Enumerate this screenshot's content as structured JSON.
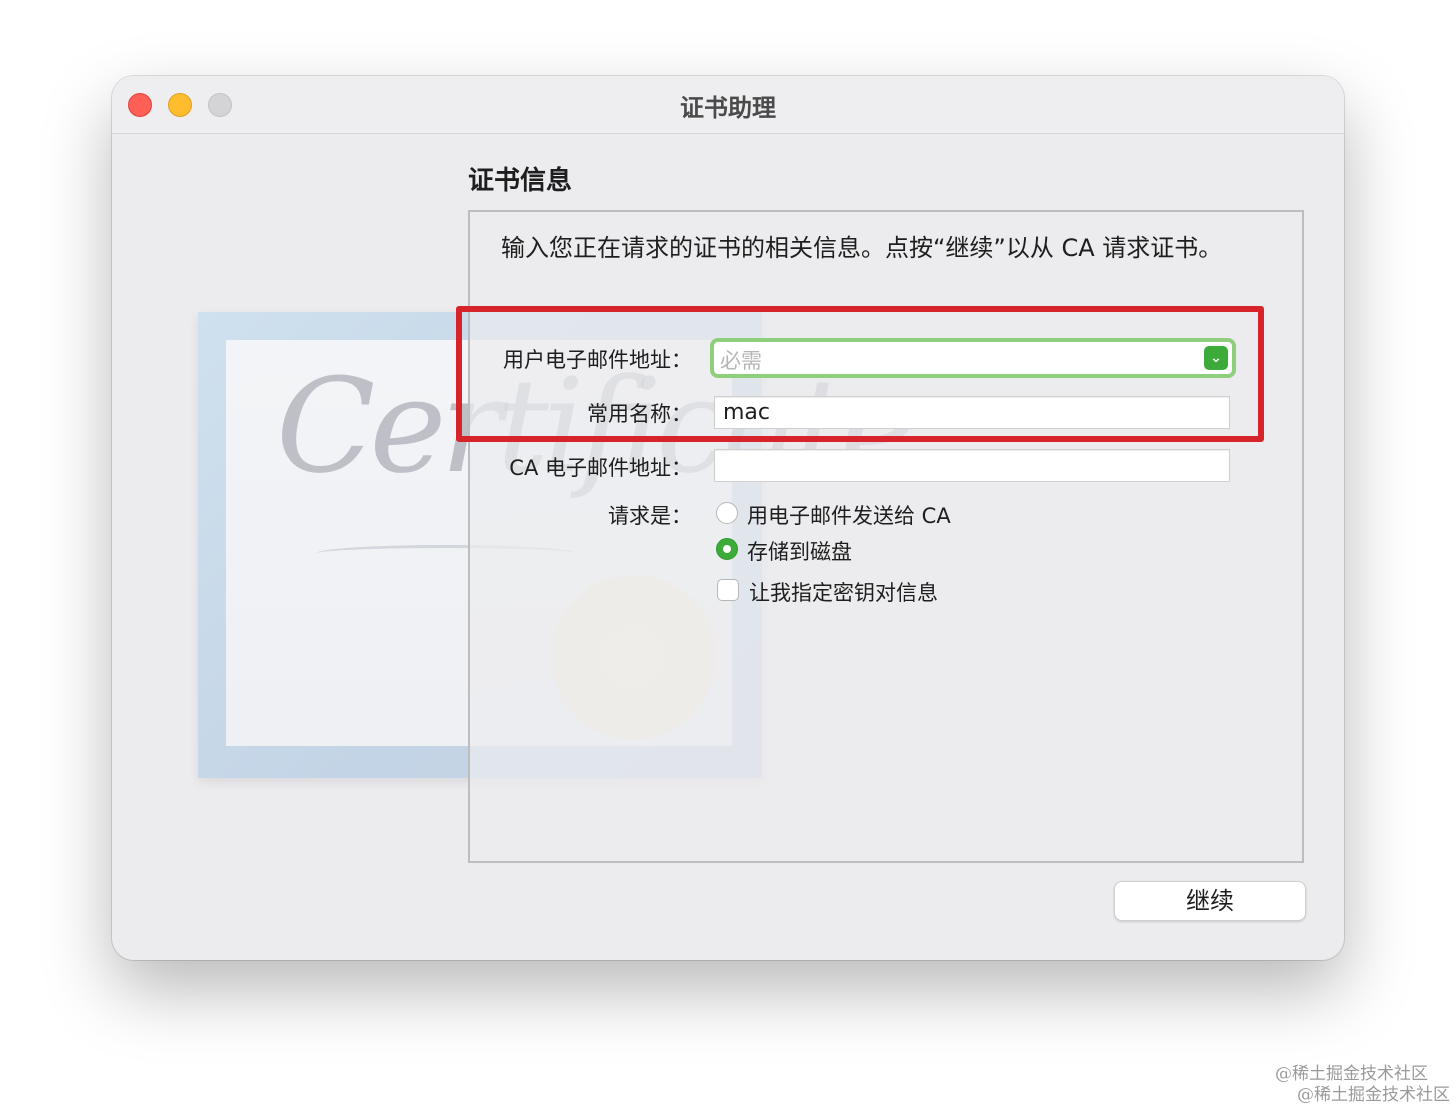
{
  "window": {
    "title": "证书助理"
  },
  "background_art": {
    "text": "Certificate"
  },
  "section": {
    "title": "证书信息"
  },
  "description": "输入您正在请求的证书的相关信息。点按“继续”以从 CA 请求证书。",
  "form": {
    "email_label": "用户电子邮件地址：",
    "email_placeholder": "必需",
    "email_value": "",
    "common_name_label": "常用名称：",
    "common_name_value": "mac",
    "ca_email_label": "CA 电子邮件地址：",
    "ca_email_value": "",
    "request_label": "请求是：",
    "options": {
      "email_to_ca": "用电子邮件发送给 CA",
      "save_to_disk": "存储到磁盘",
      "specify_key_pair": "让我指定密钥对信息"
    },
    "selected_option": "save_to_disk"
  },
  "continue_button": "继续",
  "watermarks": [
    "@稀土掘金技术社区",
    "@稀土掘金技术社区"
  ],
  "colors": {
    "highlight": "#d6242a",
    "accent": "#3dab3a",
    "focus_ring": "#8fce7c"
  },
  "icons": {
    "combo": "chevron-down-icon"
  }
}
